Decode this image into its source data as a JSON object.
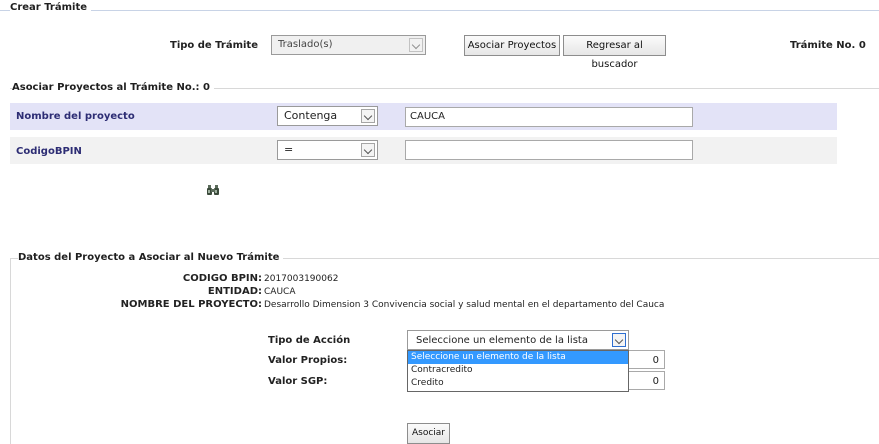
{
  "crear": {
    "legend": "Crear Trámite",
    "tipo_label": "Tipo de Trámite",
    "tipo_value": "Traslado(s)",
    "asociar_btn": "Asociar Proyectos",
    "regresar_btn": "Regresar al buscador",
    "tramite_no": "Trámite No. 0"
  },
  "asociar": {
    "legend": "Asociar Proyectos al Trámite No.: 0",
    "filters": [
      {
        "label": "Nombre del proyecto",
        "operator": "Contenga",
        "value": "CAUCA"
      },
      {
        "label": "CodigoBPIN",
        "operator": "=",
        "value": ""
      }
    ],
    "search_icon": "binoculars-icon"
  },
  "datos": {
    "legend": "Datos del Proyecto a Asociar al Nuevo Trámite",
    "bpin_label": "CODIGO BPIN:",
    "bpin_value": "2017003190062",
    "entidad_label": "ENTIDAD:",
    "entidad_value": "CAUCA",
    "nombre_label": "NOMBRE DEL PROYECTO:",
    "nombre_value": "Desarrollo Dimension 3 Convivencia social y salud mental en el departamento del Cauca",
    "accion_label": "Tipo de Acción",
    "accion_value": "Seleccione un elemento de la lista",
    "accion_options": [
      "Seleccione un elemento de la lista",
      "Contracredito",
      "Credito"
    ],
    "propios_label": "Valor Propios:",
    "propios_value": "0",
    "sgp_label": "Valor SGP:",
    "sgp_value": "0",
    "asociar_btn": "Asociar"
  },
  "colors": {
    "highlight_row": "#e3e3f7",
    "alt_row": "#f2f2f2",
    "option_selected": "#3399ff",
    "label_blue": "#2d2d74"
  }
}
